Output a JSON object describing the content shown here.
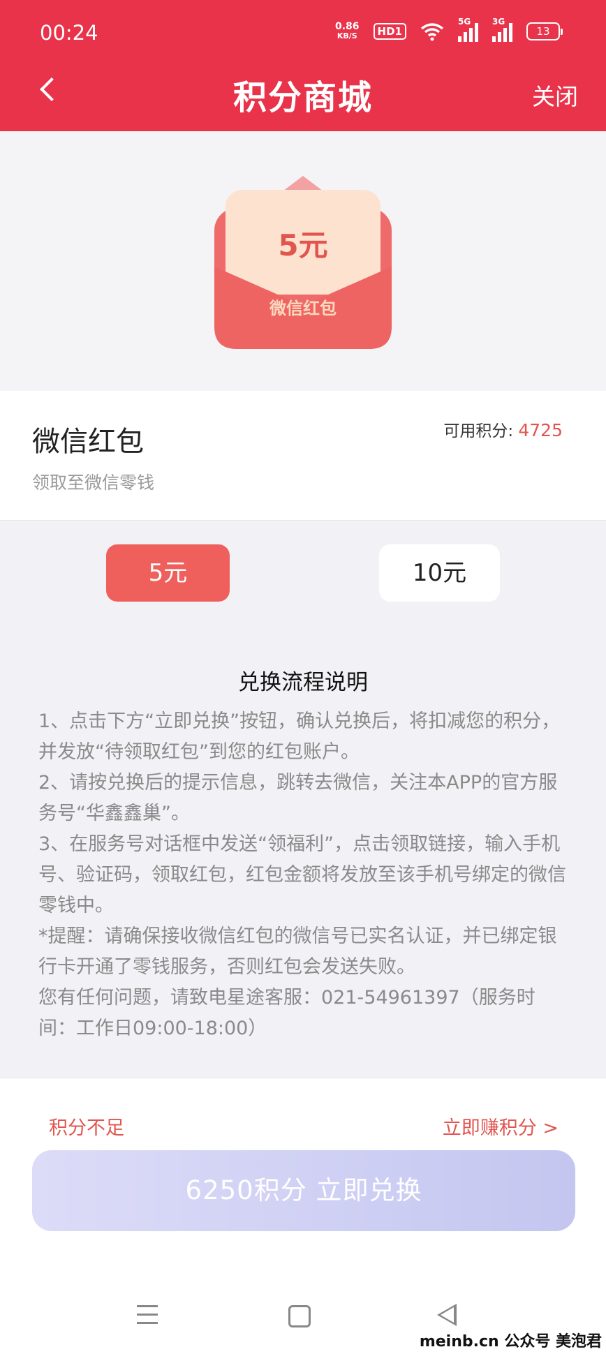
{
  "status_bar": {
    "time": "00:24",
    "speed_value": "0.86",
    "speed_unit": "KB/S",
    "hd_badge": "HD1",
    "signal_1_label": "5G",
    "signal_2_label": "3G",
    "battery": "13"
  },
  "header": {
    "title": "积分商城",
    "close_label": "关闭",
    "background_color": "#e8334a"
  },
  "hero": {
    "amount": "5元",
    "label": "微信红包"
  },
  "product": {
    "name": "微信红包",
    "subtitle": "领取至微信零钱",
    "points_label": "可用积分:",
    "points_value": "4725"
  },
  "options": [
    {
      "label": "5元",
      "selected": true
    },
    {
      "label": "10元",
      "selected": false
    }
  ],
  "instructions": {
    "title": "兑换流程说明",
    "lines": [
      "1、点击下方“立即兑换”按钮，确认兑换后，将扣减您的积分，并发放“待领取红包”到您的红包账户。",
      "2、请按兑换后的提示信息，跳转去微信，关注本APP的官方服务号“华鑫鑫巢”。",
      "3、在服务号对话框中发送“领福利”，点击领取链接，输入手机号、验证码，领取红包，红包金额将发放至该手机号绑定的微信零钱中。",
      "*提醒：请确保接收微信红包的微信号已实名认证，并已绑定银行卡开通了零钱服务，否则红包会发送失败。",
      "您有任何问题，请致电星途客服：021-54961397（服务时间：工作日09:00-18:00）"
    ]
  },
  "footer": {
    "insufficient_label": "积分不足",
    "earn_label": "立即赚积分 >",
    "redeem_button": "6250积分 立即兑换",
    "accent_color": "#e2554f"
  },
  "watermark": "meinb.cn 公众号 美泡君"
}
